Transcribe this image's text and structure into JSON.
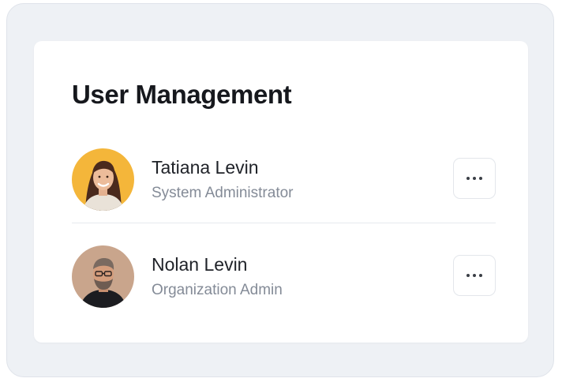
{
  "panel": {
    "title": "User Management"
  },
  "users": [
    {
      "name": "Tatiana Levin",
      "role": "System Administrator",
      "avatar_bg": "#f4b63a",
      "actions_icon": "more-horizontal-icon"
    },
    {
      "name": "Nolan Levin",
      "role": "Organization Admin",
      "avatar_bg": "#c9a58c",
      "actions_icon": "more-horizontal-icon"
    }
  ],
  "colors": {
    "frame_bg": "#eef1f5",
    "card_bg": "#ffffff",
    "title_text": "#16181d",
    "secondary_text": "#848b97",
    "divider": "#e6e9ee"
  }
}
